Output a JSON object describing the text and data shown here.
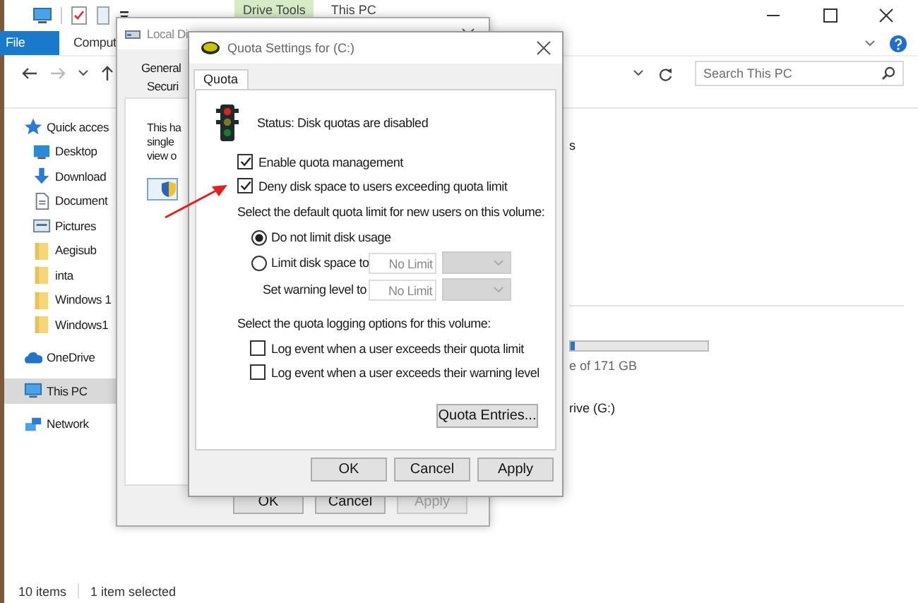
{
  "explorer": {
    "context_tab": "Drive Tools",
    "title": "This PC",
    "ribbon_tabs": [
      {
        "label": "File",
        "kind": "file"
      },
      {
        "label": "Comput",
        "kind": "tab"
      }
    ],
    "search": {
      "placeholder": "Search This PC"
    },
    "sidebar": {
      "items": [
        {
          "label": "Quick acces",
          "kind": "star",
          "selected": false
        },
        {
          "label": "Desktop",
          "kind": "desktop",
          "selected": false
        },
        {
          "label": "Download",
          "kind": "download",
          "selected": false
        },
        {
          "label": "Document",
          "kind": "document",
          "selected": false
        },
        {
          "label": "Pictures",
          "kind": "pictures",
          "selected": false
        },
        {
          "label": "Aegisub",
          "kind": "folder",
          "selected": false
        },
        {
          "label": "inta",
          "kind": "folder",
          "selected": false
        },
        {
          "label": "Windows 1",
          "kind": "folder",
          "selected": false
        },
        {
          "label": "Windows1",
          "kind": "folder",
          "selected": false
        },
        {
          "label": "OneDrive",
          "kind": "cloud",
          "selected": false
        },
        {
          "label": "This PC",
          "kind": "pc",
          "selected": true
        },
        {
          "label": "Network",
          "kind": "network",
          "selected": false
        }
      ]
    },
    "content": {
      "heading_fragment": "s",
      "drive": {
        "level": 0.03,
        "size_fragment": "e of 171 GB"
      },
      "drive_fragment": "rive (G:)"
    },
    "status_bar": [
      "10 items",
      "1 item selected"
    ]
  },
  "properties_window": {
    "title": "Local Di",
    "tabs": [
      {
        "label": "General"
      },
      {
        "label": "Securi"
      }
    ],
    "text_lines": [
      "This ha",
      "single",
      "view o"
    ],
    "buttons": [
      {
        "label": "OK",
        "disabled": false
      },
      {
        "label": "Cancel",
        "disabled": false
      },
      {
        "label": "Apply",
        "disabled": true
      }
    ]
  },
  "quota_dialog": {
    "title": "Quota Settings for  (C:)",
    "tab": "Quota",
    "status": "Status:  Disk quotas are disabled",
    "options": [
      {
        "label": "Enable quota management",
        "checked": true
      },
      {
        "label": "Deny disk space to users exceeding quota limit",
        "checked": true
      }
    ],
    "limit_label": "Select the default quota limit for new users on this volume:",
    "limit_choices": [
      {
        "label": "Do not limit disk usage",
        "selected": true
      },
      {
        "label": "Limit disk space to",
        "selected": false,
        "value": "No Limit",
        "disabled": true
      }
    ],
    "warning": {
      "label": "Set warning level to",
      "value": "No Limit",
      "disabled": true
    },
    "logging_label": "Select the quota logging options for this volume:",
    "logging": [
      {
        "label": "Log event when a user exceeds their quota limit",
        "checked": false
      },
      {
        "label": "Log event when a user exceeds their warning level",
        "checked": false
      }
    ],
    "entries_button": "Quota Entries...",
    "buttons": [
      {
        "label": "OK",
        "disabled": false
      },
      {
        "label": "Cancel",
        "disabled": false
      },
      {
        "label": "Apply",
        "disabled": false
      }
    ]
  }
}
